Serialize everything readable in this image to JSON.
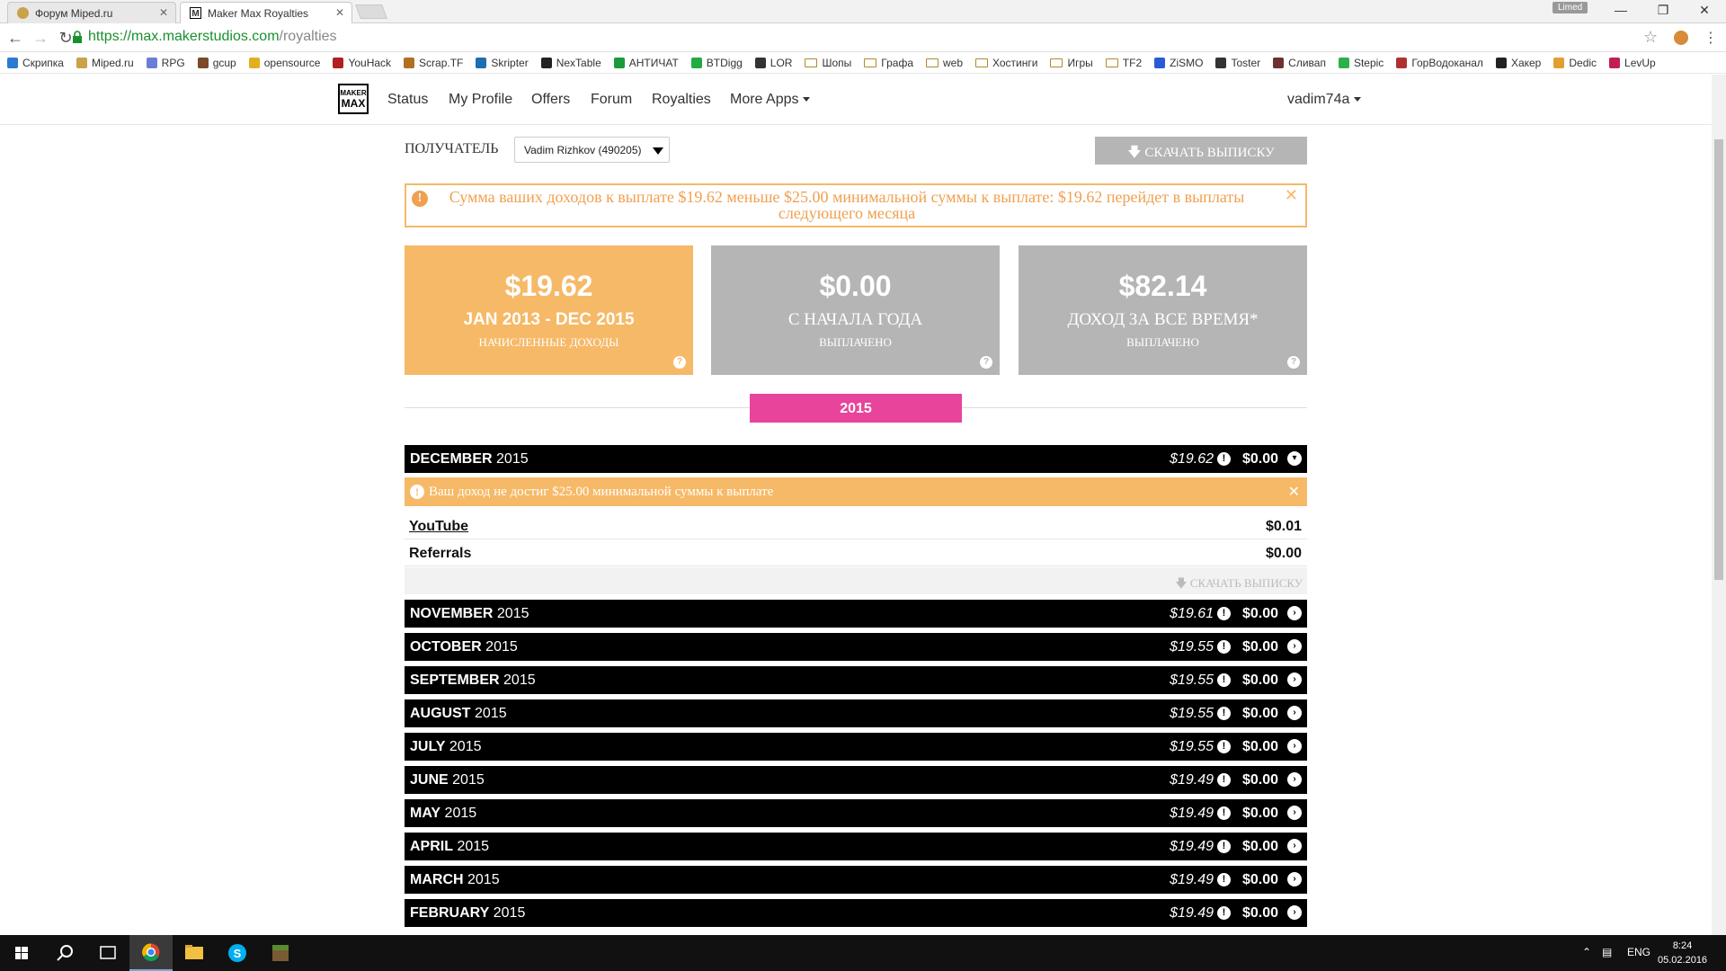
{
  "browser": {
    "tabs": [
      {
        "title": "Форум Miped.ru",
        "active": false
      },
      {
        "title": "Maker Max Royalties",
        "active": true
      }
    ],
    "user_badge": "Limed",
    "url_host": "https://max.makerstudios.com",
    "url_path": "/royalties",
    "bookmarks": [
      "Скрипка",
      "Miped.ru",
      "RPG",
      "gcup",
      "opensource",
      "YouHack",
      "Scrap.TF",
      "Skripter",
      "NexTable",
      "АНТИЧАТ",
      "BTDigg",
      "LOR",
      "Шопы",
      "Графа",
      "web",
      "Хостинги",
      "Игры",
      "TF2",
      "ZiSMO",
      "Toster",
      "Сливап",
      "Stepic",
      "ГорВодоканал",
      "Хакер",
      "Dedic",
      "LevUp"
    ]
  },
  "nav": {
    "logo_top": "MAKER",
    "logo_bottom": "MAX",
    "items": [
      "Status",
      "My Profile",
      "Offers",
      "Forum",
      "Royalties",
      "More Apps"
    ],
    "user": "vadim74a"
  },
  "recipient": {
    "label": "ПОЛУЧАТЕЛЬ",
    "value": "Vadim Rizhkov (490205)"
  },
  "download_label": "СКАЧАТЬ ВЫПИСКУ",
  "alert_text": "Сумма ваших доходов к выплате $19.62 меньше $25.00 минимальной суммы к выплате: $19.62 перейдет в выплаты следующего месяца",
  "cards": [
    {
      "amount": "$19.62",
      "period": "JAN 2013 - DEC 2015",
      "sub": "НАЧИСЛЕННЫЕ ДОХОДЫ",
      "color": "#f6b967"
    },
    {
      "amount": "$0.00",
      "period": "С НАЧАЛА ГОДА",
      "sub": "ВЫПЛАЧЕНО",
      "color": "#b5b5b5"
    },
    {
      "amount": "$82.14",
      "period": "ДОХОД ЗА ВСЕ ВРЕМЯ*",
      "sub": "ВЫПЛАЧЕНО",
      "color": "#b5b5b5"
    }
  ],
  "year": "2015",
  "months": [
    {
      "month": "DECEMBER",
      "year": "2015",
      "accrued": "$19.62",
      "paid": "$0.00",
      "expanded": true
    },
    {
      "month": "NOVEMBER",
      "year": "2015",
      "accrued": "$19.61",
      "paid": "$0.00"
    },
    {
      "month": "OCTOBER",
      "year": "2015",
      "accrued": "$19.55",
      "paid": "$0.00"
    },
    {
      "month": "SEPTEMBER",
      "year": "2015",
      "accrued": "$19.55",
      "paid": "$0.00"
    },
    {
      "month": "AUGUST",
      "year": "2015",
      "accrued": "$19.55",
      "paid": "$0.00"
    },
    {
      "month": "JULY",
      "year": "2015",
      "accrued": "$19.55",
      "paid": "$0.00"
    },
    {
      "month": "JUNE",
      "year": "2015",
      "accrued": "$19.49",
      "paid": "$0.00"
    },
    {
      "month": "MAY",
      "year": "2015",
      "accrued": "$19.49",
      "paid": "$0.00"
    },
    {
      "month": "APRIL",
      "year": "2015",
      "accrued": "$19.49",
      "paid": "$0.00"
    },
    {
      "month": "MARCH",
      "year": "2015",
      "accrued": "$19.49",
      "paid": "$0.00"
    },
    {
      "month": "FEBRUARY",
      "year": "2015",
      "accrued": "$19.49",
      "paid": "$0.00"
    }
  ],
  "month_alert": "Ваш доход не достиг $25.00 минимальной суммы к выплате",
  "details": [
    {
      "label": "YouTube",
      "value": "$0.01"
    },
    {
      "label": "Referrals",
      "value": "$0.00"
    }
  ],
  "taskbar": {
    "lang": "ENG",
    "time": "8:24",
    "date": "05.02.2016"
  }
}
